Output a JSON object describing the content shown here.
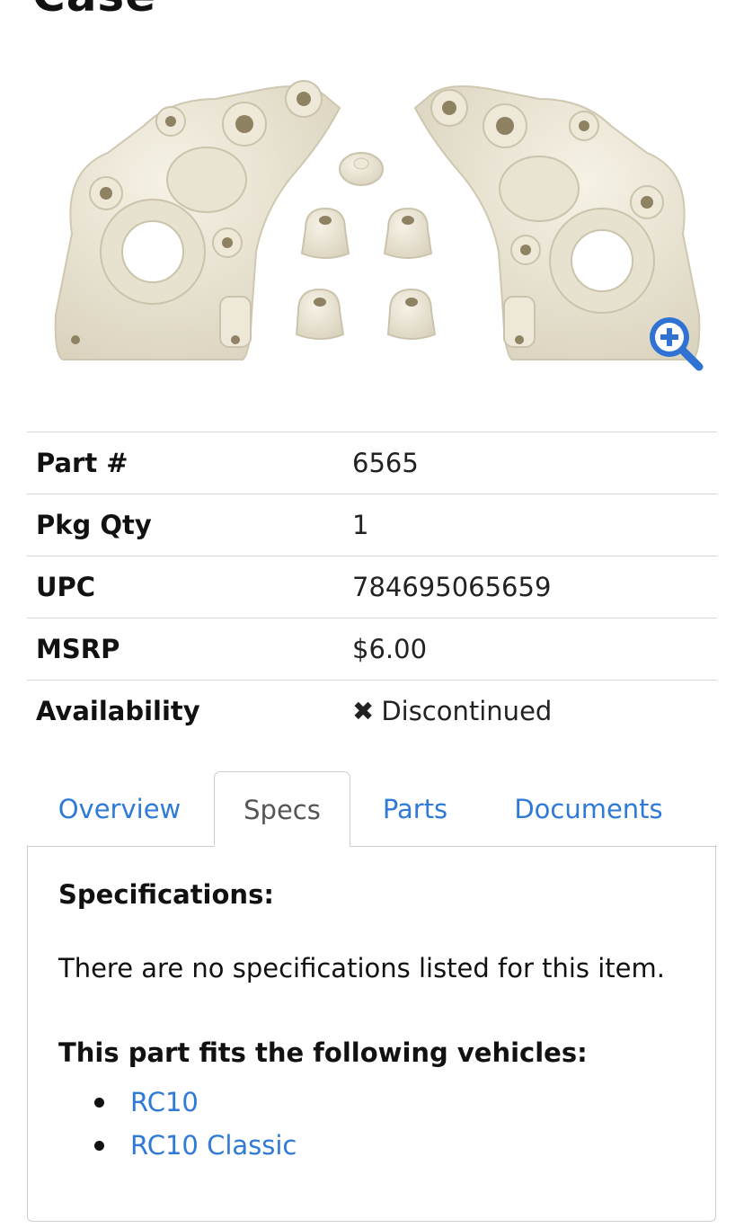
{
  "page": {
    "title_fragment": "Case"
  },
  "product": {
    "image_alt": "Plastic gearbox case halves with bushings",
    "zoom_icon": "zoom-in-icon"
  },
  "details": {
    "rows": [
      {
        "label": "Part #",
        "value": "6565"
      },
      {
        "label": "Pkg Qty",
        "value": "1"
      },
      {
        "label": "UPC",
        "value": "784695065659"
      },
      {
        "label": "MSRP",
        "value": "$6.00"
      },
      {
        "label": "Availability",
        "value": "Discontinued",
        "status_icon": "x-icon"
      }
    ]
  },
  "tabs": [
    {
      "label": "Overview",
      "active": false
    },
    {
      "label": "Specs",
      "active": true
    },
    {
      "label": "Parts",
      "active": false
    },
    {
      "label": "Documents",
      "active": false
    }
  ],
  "specs_panel": {
    "heading": "Specifications:",
    "message": "There are no specifications listed for this item.",
    "fits_heading": "This part fits the following vehicles:",
    "vehicles": [
      "RC10",
      "RC10 Classic"
    ]
  },
  "colors": {
    "link": "#2f7ad6",
    "discontinued": "#c9474a",
    "zoom_icon": "#2f72d1",
    "part_plastic": "#ece7d7"
  }
}
